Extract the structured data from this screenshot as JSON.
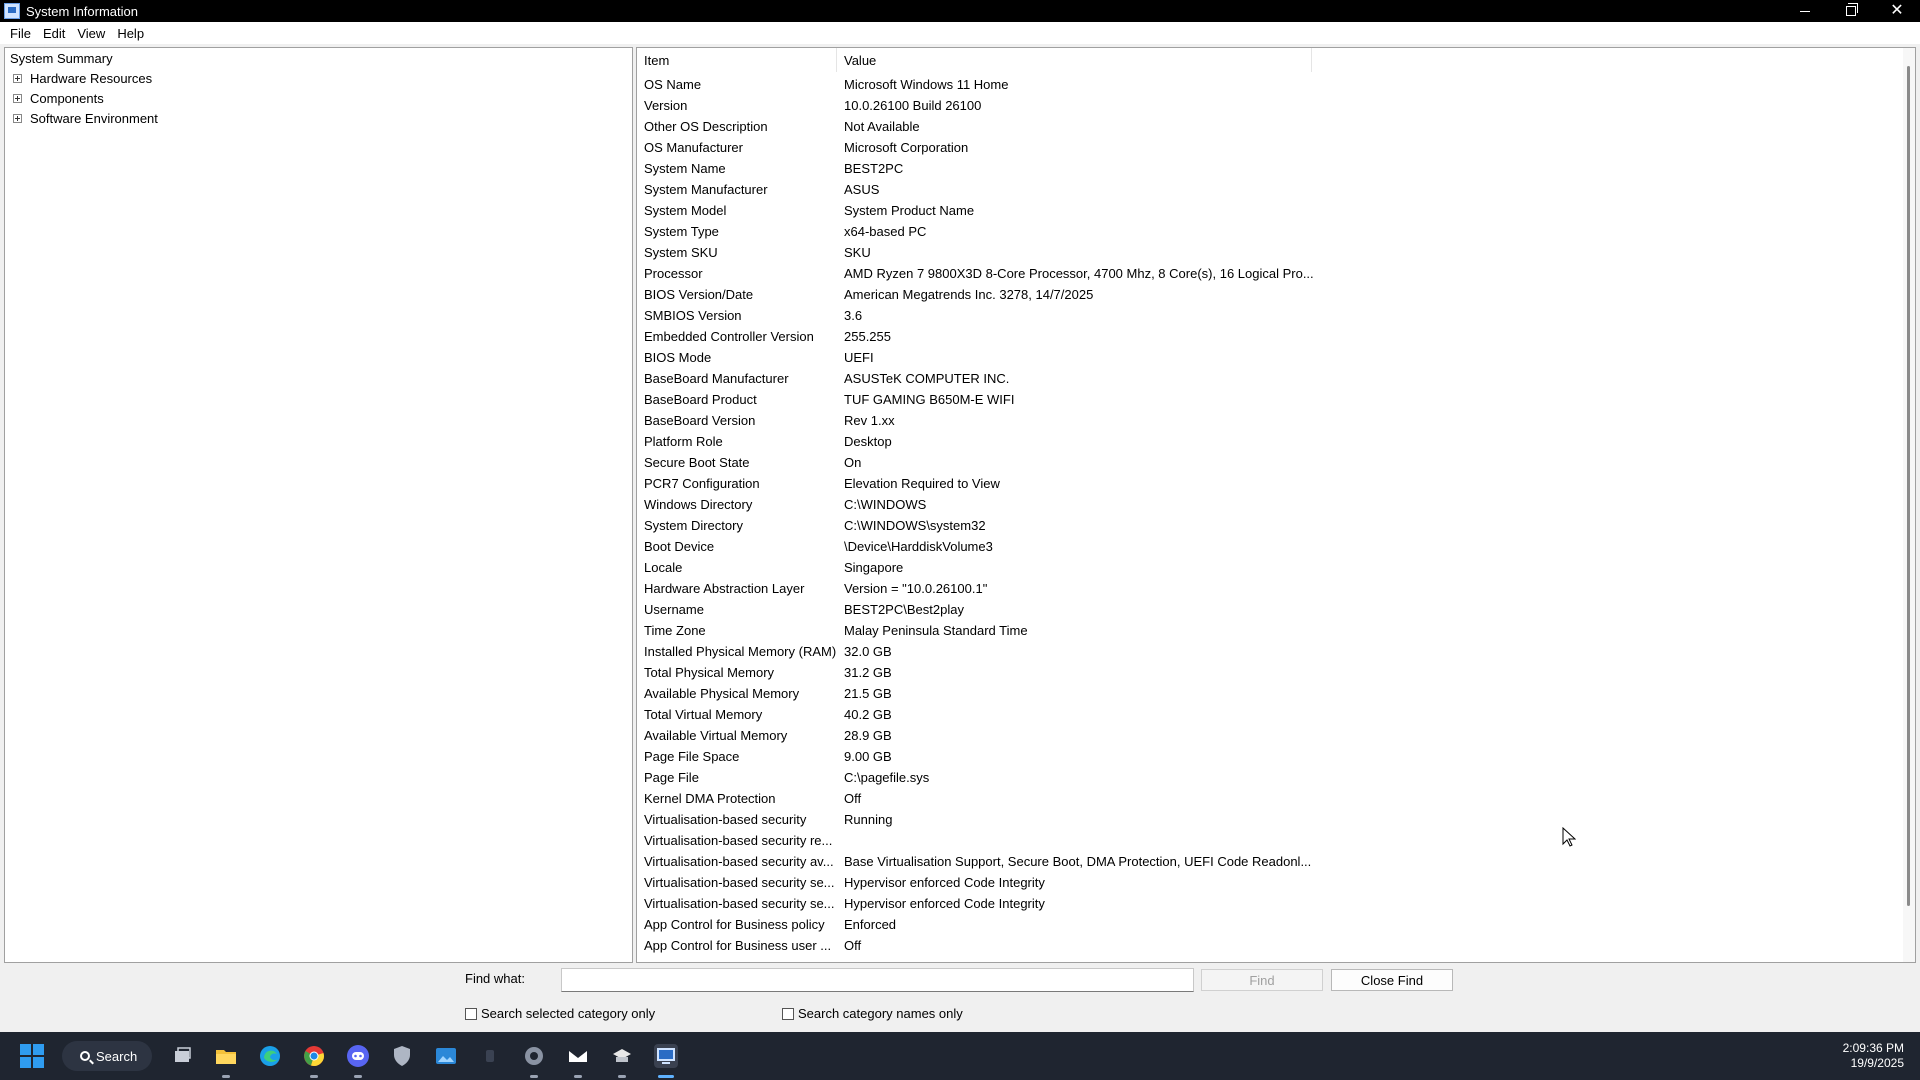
{
  "window": {
    "title": "System Information",
    "minimize_glyph": "",
    "restore_glyph": "",
    "close_glyph": "✕"
  },
  "menu": [
    "File",
    "Edit",
    "View",
    "Help"
  ],
  "tree": {
    "root": "System Summary",
    "children": [
      "Hardware Resources",
      "Components",
      "Software Environment"
    ]
  },
  "table": {
    "columns": [
      "Item",
      "Value"
    ],
    "rows": [
      {
        "item": "OS Name",
        "value": "Microsoft Windows 11 Home"
      },
      {
        "item": "Version",
        "value": "10.0.26100 Build 26100"
      },
      {
        "item": "Other OS Description",
        "value": "Not Available"
      },
      {
        "item": "OS Manufacturer",
        "value": "Microsoft Corporation"
      },
      {
        "item": "System Name",
        "value": "BEST2PC"
      },
      {
        "item": "System Manufacturer",
        "value": "ASUS"
      },
      {
        "item": "System Model",
        "value": "System Product Name"
      },
      {
        "item": "System Type",
        "value": "x64-based PC"
      },
      {
        "item": "System SKU",
        "value": "SKU"
      },
      {
        "item": "Processor",
        "value": "AMD Ryzen 7 9800X3D 8-Core Processor, 4700 Mhz, 8 Core(s), 16 Logical Pro..."
      },
      {
        "item": "BIOS Version/Date",
        "value": "American Megatrends Inc. 3278, 14/7/2025"
      },
      {
        "item": "SMBIOS Version",
        "value": "3.6"
      },
      {
        "item": "Embedded Controller Version",
        "value": "255.255"
      },
      {
        "item": "BIOS Mode",
        "value": "UEFI"
      },
      {
        "item": "BaseBoard Manufacturer",
        "value": "ASUSTeK COMPUTER INC."
      },
      {
        "item": "BaseBoard Product",
        "value": "TUF GAMING B650M-E WIFI"
      },
      {
        "item": "BaseBoard Version",
        "value": "Rev 1.xx"
      },
      {
        "item": "Platform Role",
        "value": "Desktop"
      },
      {
        "item": "Secure Boot State",
        "value": "On"
      },
      {
        "item": "PCR7 Configuration",
        "value": "Elevation Required to View"
      },
      {
        "item": "Windows Directory",
        "value": "C:\\WINDOWS"
      },
      {
        "item": "System Directory",
        "value": "C:\\WINDOWS\\system32"
      },
      {
        "item": "Boot Device",
        "value": "\\Device\\HarddiskVolume3"
      },
      {
        "item": "Locale",
        "value": "Singapore"
      },
      {
        "item": "Hardware Abstraction Layer",
        "value": "Version = \"10.0.26100.1\""
      },
      {
        "item": "Username",
        "value": "BEST2PC\\Best2play"
      },
      {
        "item": "Time Zone",
        "value": "Malay Peninsula Standard Time"
      },
      {
        "item": "Installed Physical Memory (RAM)",
        "value": "32.0 GB"
      },
      {
        "item": "Total Physical Memory",
        "value": "31.2 GB"
      },
      {
        "item": "Available Physical Memory",
        "value": "21.5 GB"
      },
      {
        "item": "Total Virtual Memory",
        "value": "40.2 GB"
      },
      {
        "item": "Available Virtual Memory",
        "value": "28.9 GB"
      },
      {
        "item": "Page File Space",
        "value": "9.00 GB"
      },
      {
        "item": "Page File",
        "value": "C:\\pagefile.sys"
      },
      {
        "item": "Kernel DMA Protection",
        "value": "Off"
      },
      {
        "item": "Virtualisation-based security",
        "value": "Running"
      },
      {
        "item": "Virtualisation-based security re...",
        "value": ""
      },
      {
        "item": "Virtualisation-based security av...",
        "value": "Base Virtualisation Support, Secure Boot, DMA Protection, UEFI Code Readonl..."
      },
      {
        "item": "Virtualisation-based security se...",
        "value": "Hypervisor enforced Code Integrity"
      },
      {
        "item": "Virtualisation-based security se...",
        "value": "Hypervisor enforced Code Integrity"
      },
      {
        "item": "App Control for Business policy",
        "value": "Enforced"
      },
      {
        "item": "App Control for Business user ...",
        "value": "Off"
      }
    ]
  },
  "find": {
    "label": "Find what:",
    "value": "",
    "find_button": "Find",
    "close_button": "Close Find",
    "option_selected_category": "Search selected category only",
    "option_category_names": "Search category names only",
    "option_selected_category_checked": false,
    "option_category_names_checked": false
  },
  "taskbar": {
    "search_label": "Search",
    "apps": [
      "task-view",
      "file-explorer",
      "edge",
      "chrome",
      "discord",
      "security-app",
      "photos-app",
      "generic-app",
      "settings",
      "mail-app",
      "tools-app",
      "system-information"
    ],
    "active_app": "system-information",
    "clock_time": "2:09:36 PM",
    "clock_date": "19/9/2025"
  },
  "colors": {
    "titlebar_bg": "#000000",
    "taskbar_bg": "#1f2530",
    "accent": "#2f9cf0"
  }
}
